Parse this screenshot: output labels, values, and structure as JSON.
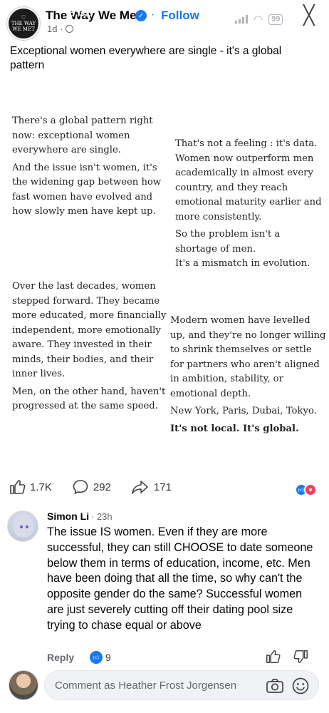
{
  "header": {
    "page_name": "The Way We Met",
    "follow_label": "Follow",
    "separator": "·",
    "overlay_time": "8:32",
    "post_meta": "1d ·",
    "avatar_line1": "THE WAY",
    "avatar_line2": "WE MET",
    "battery": "99",
    "close_glyph": "╳"
  },
  "post": {
    "text": "Exceptional women everywhere are single - it's a global pattern",
    "image_quotes": {
      "block1": [
        "There's a global pattern right now: exceptional women everywhere are single.",
        "And the issue isn't women, it's the widening gap between how fast women have evolved and how slowly men have kept up."
      ],
      "block2": [
        "That's not a feeling : it's data. Women now outperform men academically in almost every country, and they reach emotional maturity earlier and more consistently.",
        "So the problem isn't a shortage of men.",
        "It's a mismatch in evolution."
      ],
      "block3": [
        "Over the last decades, women stepped forward. They became more educated, more financially independent, more emotionally aware. They invested in their minds, their bodies, and their inner lives.",
        "Men, on the other hand, haven't progressed at the same speed."
      ],
      "block4": [
        "Modern women have levelled up, and they're no longer willing to shrink themselves or settle for partners who aren't aligned in ambition, stability, or emotional depth.",
        "New York, Paris, Dubai, Tokyo.",
        "It's not local. It's global."
      ]
    },
    "actions": {
      "likes": "1.7K",
      "comments": "292",
      "shares": "171"
    }
  },
  "comment": {
    "author": "Simon Li",
    "time": "· 23h",
    "text": "The issue IS women. Even if they are more successful, they can still CHOOSE to date someone below them in terms of education, income, etc. Men have been doing that all the time, so why can't the opposite gender do the same? Successful women are just severely cutting off their dating pool size trying to chase equal or above",
    "reply_label": "Reply",
    "like_count": "9"
  },
  "composer": {
    "placeholder": "Comment as Heather Frost Jorgensen"
  },
  "colors": {
    "accent": "#1877f2",
    "love": "#f33e58",
    "muted": "#65676b"
  },
  "icons": [
    "verified-badge-icon",
    "globe-icon",
    "signal-icon",
    "wifi-icon",
    "battery-icon",
    "close-icon",
    "like-icon",
    "comment-icon",
    "share-icon",
    "like-reaction-icon",
    "love-reaction-icon",
    "thumbs-up-icon",
    "thumbs-down-icon",
    "camera-icon",
    "emoji-icon"
  ]
}
